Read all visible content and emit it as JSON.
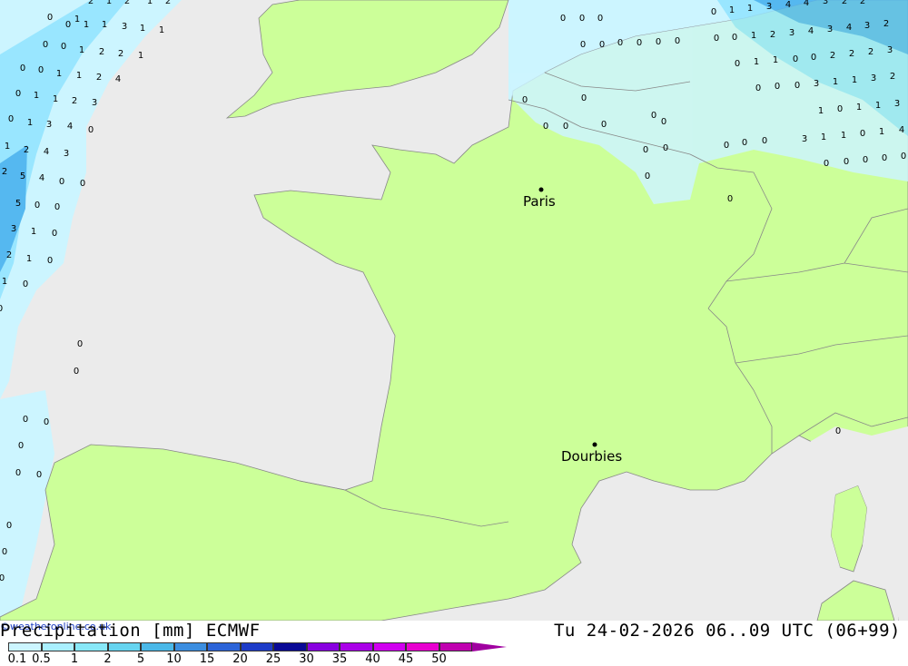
{
  "map": {
    "colors": {
      "sea": "#ebebeb",
      "land": "#ccff99",
      "border": "#888888",
      "precip_light": "#ccf5ff",
      "precip_mid": "#99e6ff",
      "precip_heavy": "#55b8f0"
    },
    "cities": [
      {
        "name": "Paris",
        "dot": "city-dot"
      },
      {
        "name": "Dourbies",
        "dot": "city-dot"
      }
    ],
    "values_west": [
      "0",
      "2",
      "1",
      "2",
      "1",
      "2",
      "1",
      "0",
      "1",
      "1",
      "3",
      "1",
      "1",
      "0",
      "0",
      "1",
      "2",
      "2",
      "1",
      "0",
      "0",
      "1",
      "1",
      "2",
      "4",
      "0",
      "1",
      "1",
      "2",
      "3",
      "0",
      "1",
      "3",
      "4",
      "0",
      "1",
      "2",
      "4",
      "3",
      "2",
      "5",
      "4",
      "0",
      "0",
      "5",
      "0",
      "0",
      "3",
      "1",
      "0",
      "2",
      "1",
      "0",
      "1",
      "0",
      "0",
      "0",
      "0",
      "0",
      "0",
      "0",
      "0",
      "0",
      "0",
      "0",
      "0"
    ],
    "values_north": [
      "0",
      "0",
      "0",
      "0",
      "0",
      "0",
      "0",
      "0",
      "0",
      "0",
      "0",
      "0",
      "0",
      "0",
      "0",
      "0",
      "0",
      "0",
      "0",
      "0",
      "0"
    ],
    "values_east": [
      "0",
      "1",
      "1",
      "3",
      "4",
      "4",
      "3",
      "2",
      "2",
      "0",
      "0",
      "1",
      "2",
      "3",
      "4",
      "3",
      "4",
      "3",
      "2",
      "0",
      "1",
      "1",
      "0",
      "0",
      "2",
      "2",
      "2",
      "3",
      "0",
      "0",
      "0",
      "3",
      "1",
      "1",
      "3",
      "2",
      "1",
      "0",
      "1",
      "1",
      "3",
      "3",
      "1",
      "1",
      "0",
      "1",
      "4",
      "0",
      "0",
      "0",
      "0",
      "0",
      "0",
      "0",
      "0"
    ]
  },
  "footer": {
    "title_left": "Precipitation [mm] ECMWF",
    "title_right": "Tu 24-02-2026 06..09 UTC (06+99)",
    "credit": "©weatheronline.co.uk",
    "legend_ticks": [
      "0.1",
      "0.5",
      "1",
      "2",
      "5",
      "10",
      "15",
      "20",
      "25",
      "30",
      "35",
      "40",
      "45",
      "50"
    ],
    "legend_colors": [
      "#ccf5ff",
      "#aaf0ff",
      "#88e8f8",
      "#66d4f0",
      "#4ab8e8",
      "#3c8ee0",
      "#2c64d8",
      "#1e3cc8",
      "#0a0a96",
      "#8800e0",
      "#aa00e8",
      "#d000f0",
      "#e800d0",
      "#c000b0"
    ]
  }
}
